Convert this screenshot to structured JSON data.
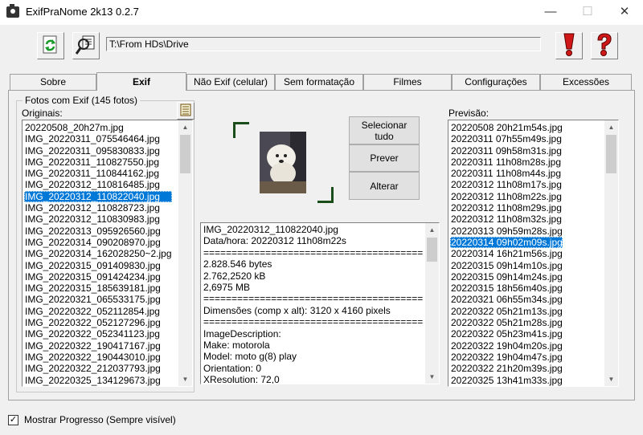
{
  "window": {
    "title": "ExifPraNome 2k13  0.2.7",
    "minimize": "—",
    "maximize": "☐",
    "close": "✕"
  },
  "toolbar": {
    "path": "T:\\From HDs\\Drive"
  },
  "tabs": [
    {
      "label": "Sobre"
    },
    {
      "label": "Exif"
    },
    {
      "label": "Não Exif (celular)"
    },
    {
      "label": "Sem formatação"
    },
    {
      "label": "Filmes"
    },
    {
      "label": "Configurações"
    },
    {
      "label": "Excessões"
    }
  ],
  "originals": {
    "group_title": "Fotos com Exif   (145 fotos)",
    "label": "Originais:",
    "items": [
      "20220508_20h27m.jpg",
      "IMG_20220311_075546464.jpg",
      "IMG_20220311_095830833.jpg",
      "IMG_20220311_110827550.jpg",
      "IMG_20220311_110844162.jpg",
      "IMG_20220312_110816485.jpg",
      "IMG_20220312_110822040.jpg",
      "IMG_20220312_110828723.jpg",
      "IMG_20220312_110830983.jpg",
      "IMG_20220313_095926560.jpg",
      "IMG_20220314_090208970.jpg",
      "IMG_20220314_162028250~2.jpg",
      "IMG_20220315_091409830.jpg",
      "IMG_20220315_091424234.jpg",
      "IMG_20220315_185639181.jpg",
      "IMG_20220321_065533175.jpg",
      "IMG_20220322_052112854.jpg",
      "IMG_20220322_052127296.jpg",
      "IMG_20220322_052341123.jpg",
      "IMG_20220322_190417167.jpg",
      "IMG_20220322_190443010.jpg",
      "IMG_20220322_212037793.jpg",
      "IMG_20220325_134129673.jpg"
    ]
  },
  "actions": {
    "select_all_line1": "Selecionar",
    "select_all_line2": "tudo",
    "preview": "Prever",
    "change": "Alterar"
  },
  "info": {
    "lines": [
      "IMG_20220312_110822040.jpg",
      "Data/hora: 20220312 11h08m22s",
      "==========================================",
      "2.828.546 bytes",
      "2.762,2520 kB",
      "2,6975 MB",
      "==========================================",
      "Dimensões (comp x alt): 3120 x 4160 pixels",
      "==========================================",
      "ImageDescription:",
      "Make: motorola",
      "Model: moto g(8) play",
      "Orientation: 0",
      "XResolution: 72,0"
    ]
  },
  "preview": {
    "label": "Previsão:",
    "items": [
      "20220508 20h21m54s.jpg",
      "20220311 07h55m49s.jpg",
      "20220311 09h58m31s.jpg",
      "20220311 11h08m28s.jpg",
      "20220311 11h08m44s.jpg",
      "20220312 11h08m17s.jpg",
      "20220312 11h08m22s.jpg",
      "20220312 11h08m29s.jpg",
      "20220312 11h08m32s.jpg",
      "20220313 09h59m28s.jpg",
      "20220314 09h02m09s.jpg",
      "20220314 16h21m56s.jpg",
      "20220315 09h14m10s.jpg",
      "20220315 09h14m24s.jpg",
      "20220315 18h56m40s.jpg",
      "20220321 06h55m34s.jpg",
      "20220322 05h21m13s.jpg",
      "20220322 05h21m28s.jpg",
      "20220322 05h23m41s.jpg",
      "20220322 19h04m20s.jpg",
      "20220322 19h04m47s.jpg",
      "20220322 21h20m39s.jpg",
      "20220325 13h41m33s.jpg"
    ]
  },
  "footer": {
    "checkbox_label": "Mostrar Progresso (Sempre visível)",
    "checked": true
  }
}
